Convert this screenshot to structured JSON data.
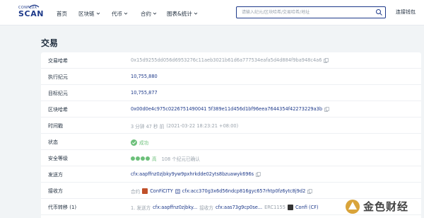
{
  "header": {
    "logo": {
      "small": "CONFLUX",
      "large": "SCAN"
    },
    "nav": [
      {
        "label": "首页",
        "has_dropdown": false
      },
      {
        "label": "区块链",
        "has_dropdown": true
      },
      {
        "label": "代币",
        "has_dropdown": true
      },
      {
        "label": "合约",
        "has_dropdown": true
      },
      {
        "label": "图表&统计",
        "has_dropdown": true
      }
    ],
    "search": {
      "placeholder": "请输入纪元/区块哈希/交易哈希/地址",
      "value": ""
    },
    "connect_wallet": "连接钱包"
  },
  "page": {
    "title": "交易"
  },
  "details": {
    "tx_hash": {
      "label": "交易哈希",
      "value": "0x15d9255dd056d6953276c11aeb3021b61d6a777534eafa5d4d884f9ba948c4a6"
    },
    "exec_epoch": {
      "label": "执行纪元",
      "value": "10,755,880"
    },
    "target_epoch": {
      "label": "目标纪元",
      "value": "10,755,877"
    },
    "block_hash": {
      "label": "区块哈希",
      "value": "0x00d0e4c975c0226751490041 5f389e11d456d1bf96eea7644354f42273229a3b"
    },
    "timestamp": {
      "label": "时间戳",
      "relative": "3 分钟 47 秒 前",
      "absolute": "(2021-03-22 18:23:21 +08:00)"
    },
    "status": {
      "label": "状态",
      "value": "成功"
    },
    "security": {
      "label": "安全等级",
      "level": "高",
      "confirmations": "108 个纪元已确认"
    },
    "from": {
      "label": "发送方",
      "value": "cfx:aapffnz0zjbky9yw9pxhrkdde02yts8bzuawyk696s"
    },
    "to": {
      "label": "接收方",
      "prefix": "合约",
      "token_name": "ConFiCITY",
      "address": "cfx:acc370g3x6d56ndcp816gyc657rhtp0fz6ytc8j9d2"
    },
    "token_transfer": {
      "label": "代币转移 (1)",
      "index": "1. 发送方",
      "from": "cfx:aapffnz0zjbky...",
      "to_label": "接收方",
      "to": "cfx:aas73g9cp0se...",
      "standard": "ERC1155",
      "token": "Confi (CF)"
    }
  },
  "watermark": {
    "text": "金色财经"
  },
  "colors": {
    "brand": "#1e3a8a",
    "success": "#6cc07a",
    "muted": "#9aa3ad",
    "text": "#1f2d3d",
    "page_bg": "#f1f4f6"
  }
}
